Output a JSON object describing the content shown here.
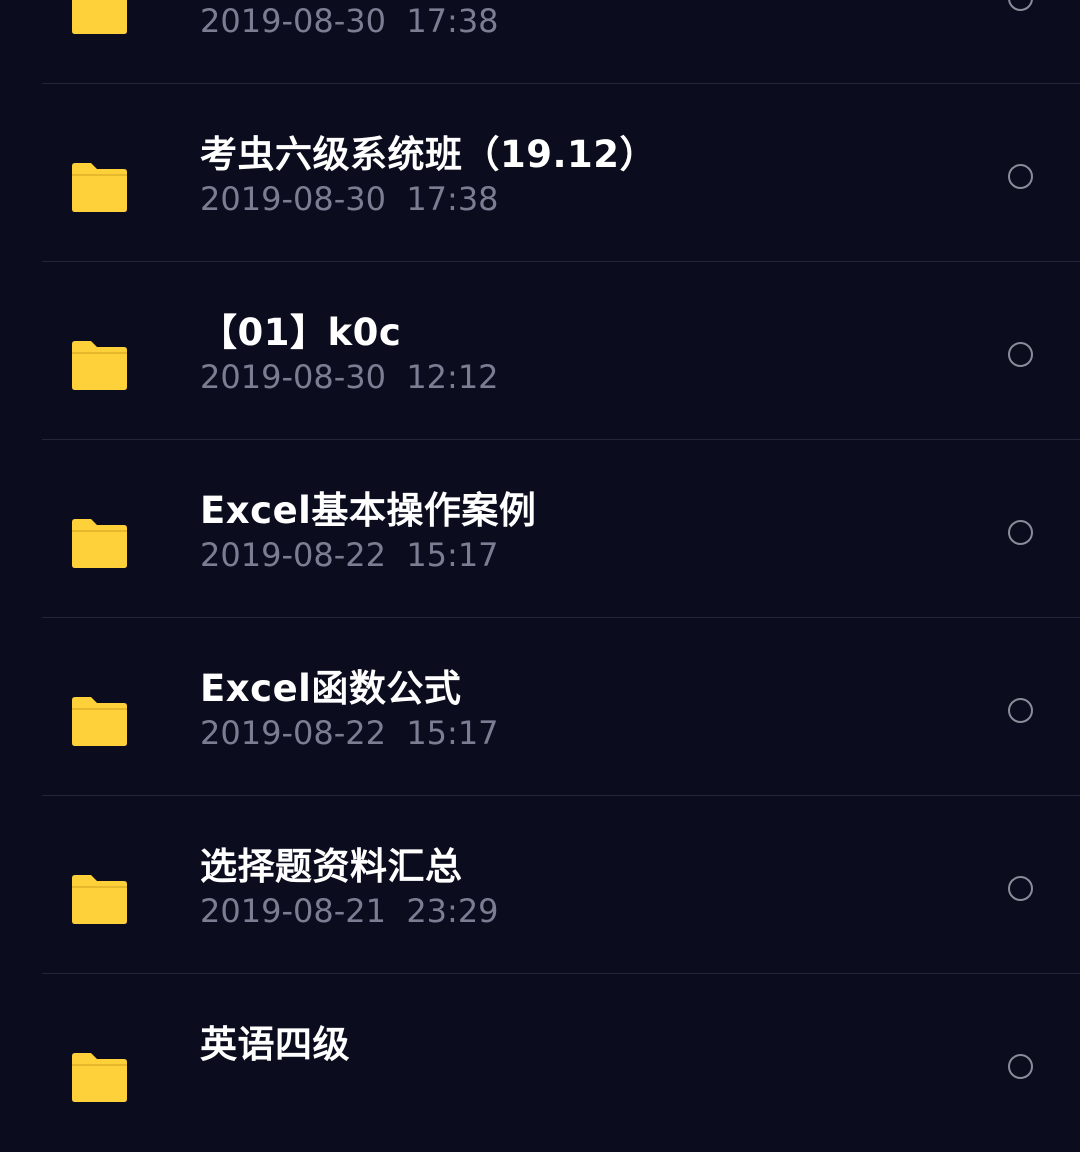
{
  "colors": {
    "background": "#0b0d1e",
    "folder": "#fed03a",
    "name": "#ffffff",
    "time": "#7b7d92",
    "divider": "#23263a",
    "radio": "#8a8c99"
  },
  "files": [
    {
      "name": "",
      "date": "2019-08-30",
      "time": "17:38",
      "icon": "folder-icon"
    },
    {
      "name": "考虫六级系统班（19.12）",
      "date": "2019-08-30",
      "time": "17:38",
      "icon": "folder-icon"
    },
    {
      "name": "【01】k0c",
      "date": "2019-08-30",
      "time": "12:12",
      "icon": "folder-icon"
    },
    {
      "name": "Excel基本操作案例",
      "date": "2019-08-22",
      "time": "15:17",
      "icon": "folder-icon"
    },
    {
      "name": "Excel函数公式",
      "date": "2019-08-22",
      "time": "15:17",
      "icon": "folder-icon"
    },
    {
      "name": "选择题资料汇总",
      "date": "2019-08-21",
      "time": "23:29",
      "icon": "folder-icon"
    },
    {
      "name": "英语四级",
      "date": "",
      "time": "",
      "icon": "folder-icon"
    }
  ]
}
